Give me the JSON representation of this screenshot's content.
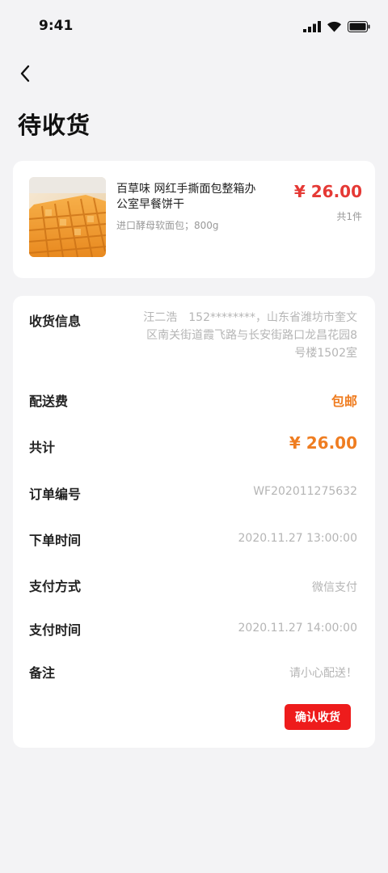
{
  "status_bar": {
    "time": "9:41",
    "icons": [
      "signal-icon",
      "wifi-icon",
      "battery-icon"
    ]
  },
  "header": {
    "back_icon": "chevron-left-icon",
    "title": "待收货"
  },
  "product": {
    "image": "waffle-biscuit-photo",
    "name": "百草味 网红手撕面包整箱办公室早餐饼干",
    "spec": "进口酵母软面包；800g",
    "price": "¥ 26.00",
    "quantity": "共1件"
  },
  "order_info": {
    "receiver_label": "收货信息",
    "receiver_value": "汪二浩　152********，山东省潍坊市奎文区南关街道霞飞路与长安街路口龙昌花园8号楼1502室",
    "shipping_label": "配送费",
    "shipping_value": "包邮",
    "total_label": "共计",
    "total_value": "¥ 26.00",
    "order_no_label": "订单编号",
    "order_no_value": "WF202011275632",
    "order_time_label": "下单时间",
    "order_time_value": "2020.11.27 13:00:00",
    "pay_method_label": "支付方式",
    "pay_method_value": "微信支付",
    "pay_time_label": "支付时间",
    "pay_time_value": "2020.11.27 14:00:00",
    "note_label": "备注",
    "note_value": "请小心配送！"
  },
  "actions": {
    "confirm_label": "确认收货"
  },
  "colors": {
    "price_red": "#e53935",
    "accent_orange": "#ef7d21",
    "button_red": "#ee1c1c",
    "background": "#f3f3f5"
  }
}
